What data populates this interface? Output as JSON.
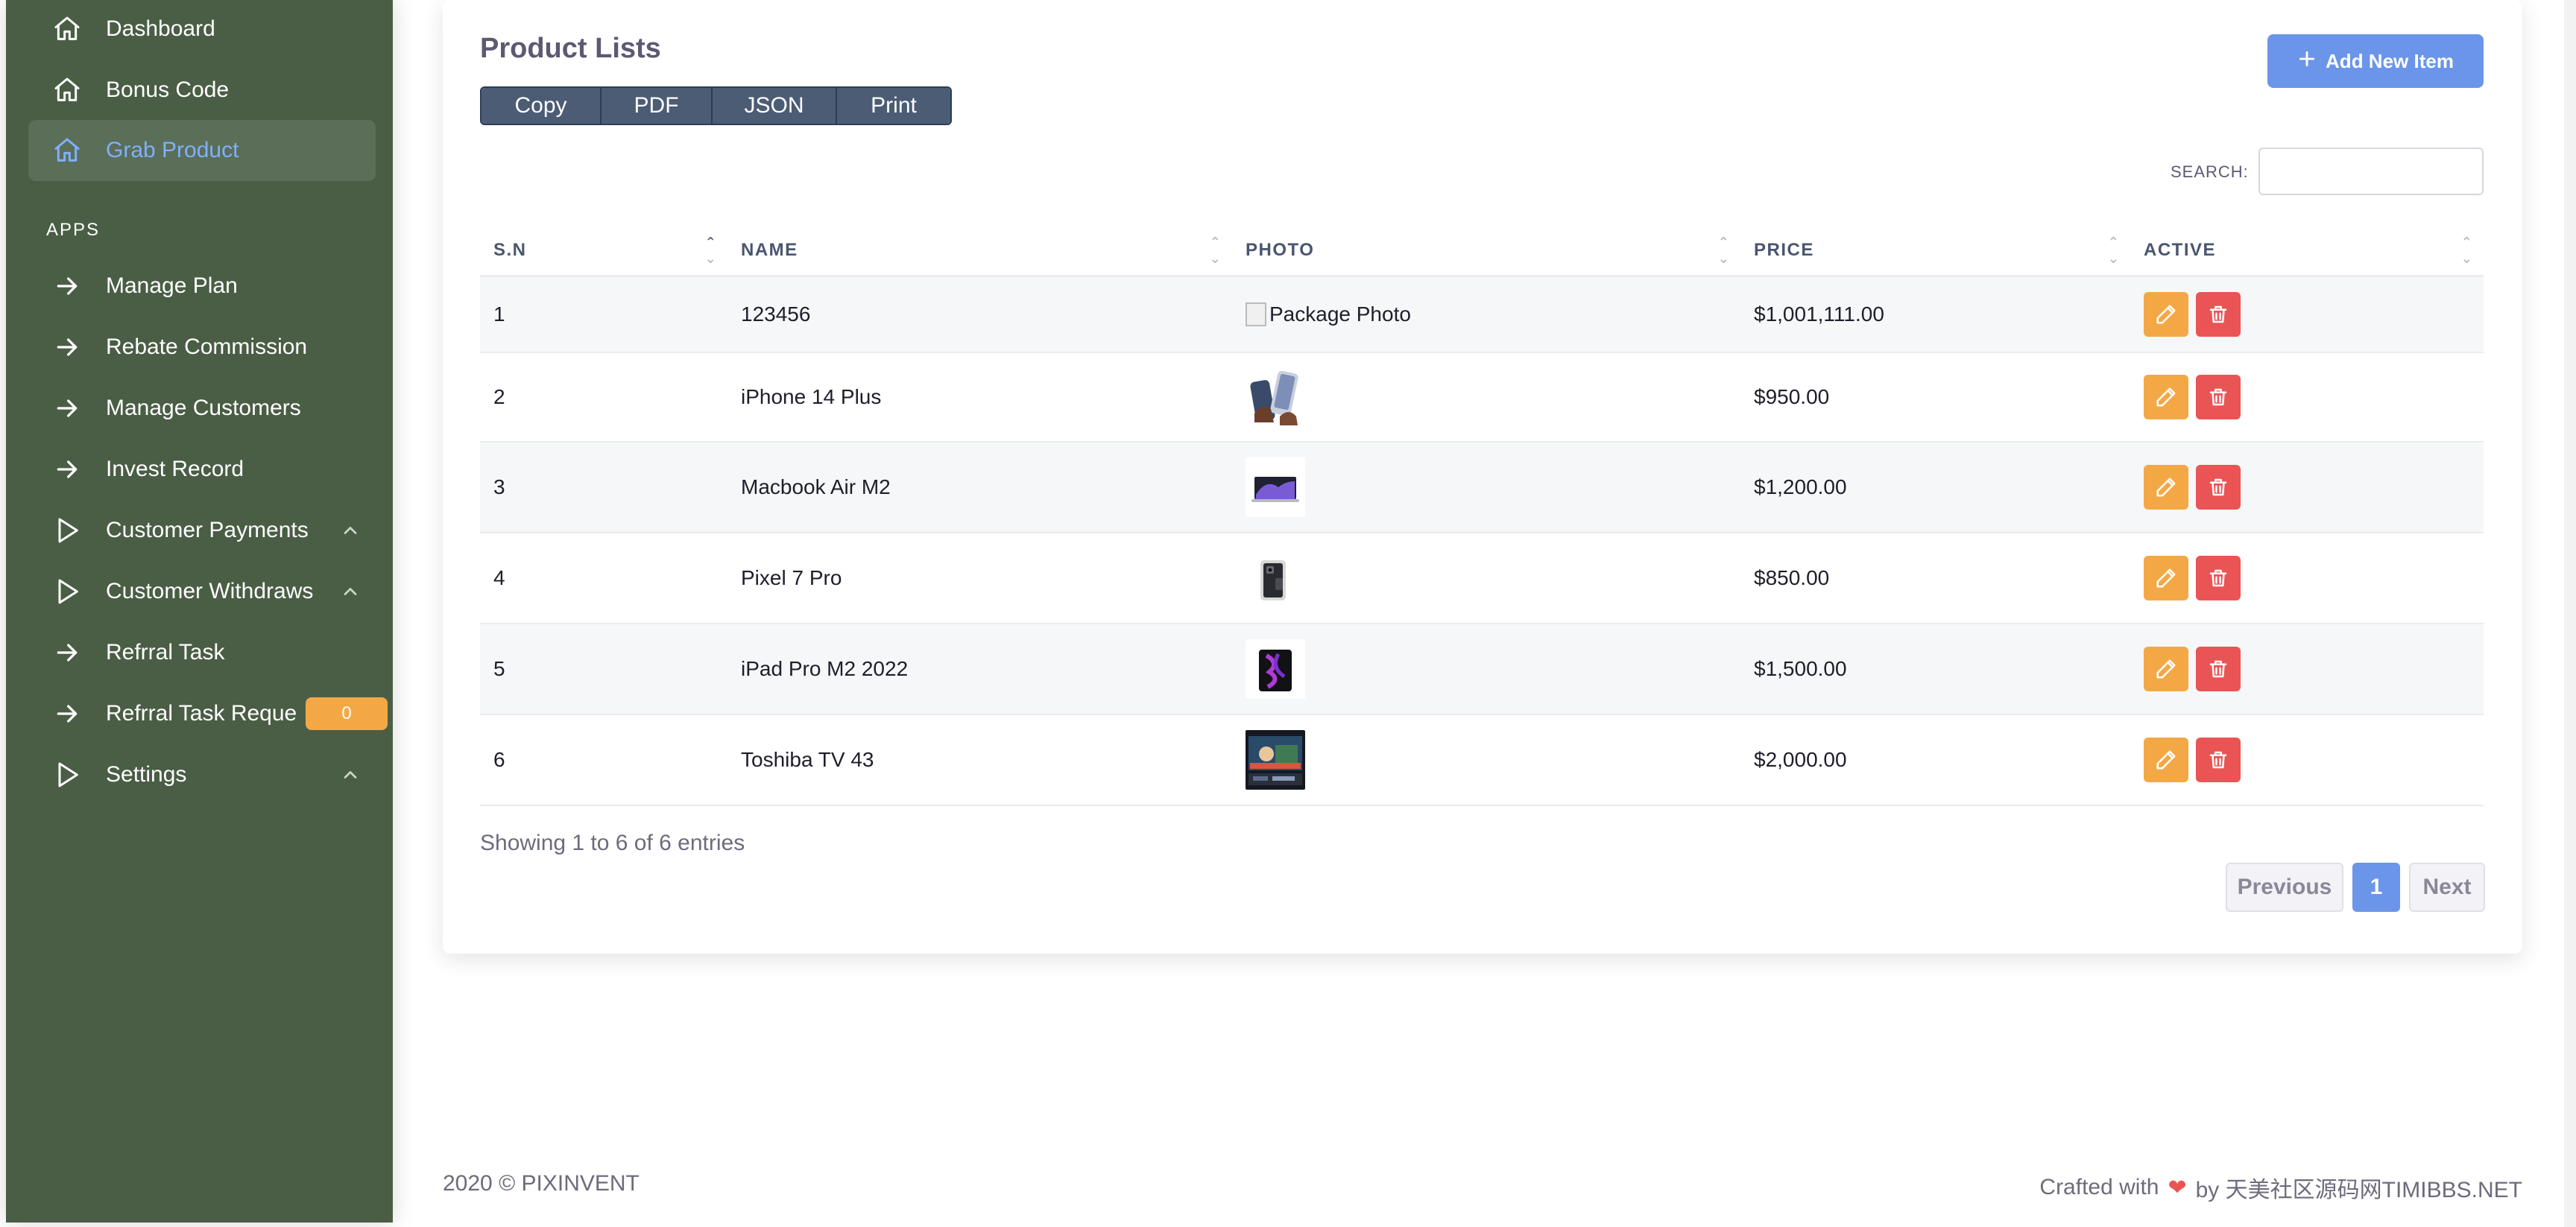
{
  "sidebar": {
    "items_top": [
      {
        "label": "Dashboard",
        "icon": "home-icon"
      },
      {
        "label": "Bonus Code",
        "icon": "home-icon"
      },
      {
        "label": "Grab Product",
        "icon": "home-icon",
        "active": true
      }
    ],
    "section_label": "APPS",
    "items_apps": [
      {
        "label": "Manage Plan",
        "icon": "arrow-right-icon"
      },
      {
        "label": "Rebate Commission",
        "icon": "arrow-right-icon"
      },
      {
        "label": "Manage Customers",
        "icon": "arrow-right-icon"
      },
      {
        "label": "Invest Record",
        "icon": "arrow-right-icon"
      },
      {
        "label": "Customer Payments",
        "icon": "play-icon",
        "chevron": true
      },
      {
        "label": "Customer Withdraws",
        "icon": "play-icon",
        "chevron": true
      },
      {
        "label": "Refrral Task",
        "icon": "arrow-right-icon"
      },
      {
        "label": "Refrral Task Reque",
        "icon": "arrow-right-icon",
        "badge": "0"
      },
      {
        "label": "Settings",
        "icon": "play-icon",
        "chevron": true
      }
    ]
  },
  "card": {
    "title": "Product Lists",
    "export_buttons": [
      "Copy",
      "PDF",
      "JSON",
      "Print"
    ],
    "add_button": "Add New Item",
    "search_label": "SEARCH:",
    "search_value": ""
  },
  "table": {
    "columns": [
      "S.N",
      "NAME",
      "PHOTO",
      "PRICE",
      "ACTIVE"
    ],
    "rows": [
      {
        "sn": "1",
        "name": "123456",
        "photo": "broken",
        "photo_alt": "Package Photo",
        "price": "$1,001,111.00"
      },
      {
        "sn": "2",
        "name": "iPhone 14 Plus",
        "photo": "iphone",
        "price": "$950.00"
      },
      {
        "sn": "3",
        "name": "Macbook Air M2",
        "photo": "macbook",
        "price": "$1,200.00"
      },
      {
        "sn": "4",
        "name": "Pixel 7 Pro",
        "photo": "pixel",
        "price": "$850.00"
      },
      {
        "sn": "5",
        "name": "iPad Pro M2 2022",
        "photo": "ipad",
        "price": "$1,500.00"
      },
      {
        "sn": "6",
        "name": "Toshiba TV 43",
        "photo": "tv",
        "price": "$2,000.00"
      }
    ],
    "entries_text": "Showing 1 to 6 of 6 entries",
    "pagination": {
      "previous": "Previous",
      "current": "1",
      "next": "Next"
    }
  },
  "footer": {
    "left": "2020 © PIXINVENT",
    "crafted": "Crafted with",
    "by": "by 天美社区源码网TIMIBBS.NET"
  },
  "colors": {
    "sidebar_bg": "#4a5d45",
    "primary": "#6b95e8",
    "edit": "#f4a845",
    "delete": "#ea5455"
  }
}
